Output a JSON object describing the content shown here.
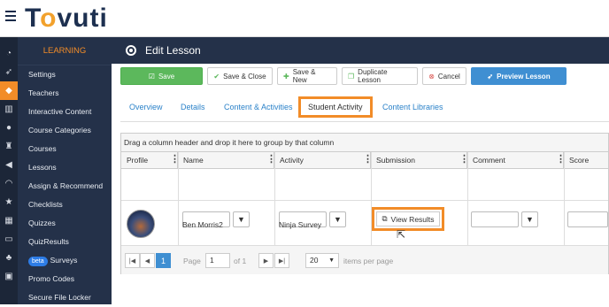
{
  "brand": {
    "logo_pre": "T",
    "logo_o": "o",
    "logo_post": "vuti"
  },
  "sidebar": {
    "section": "LEARNING",
    "items": [
      {
        "label": "Settings"
      },
      {
        "label": "Teachers"
      },
      {
        "label": "Interactive Content"
      },
      {
        "label": "Course Categories"
      },
      {
        "label": "Courses"
      },
      {
        "label": "Lessons"
      },
      {
        "label": "Assign & Recommend"
      },
      {
        "label": "Checklists"
      },
      {
        "label": "Quizzes"
      },
      {
        "label": "QuizResults"
      },
      {
        "label": "Surveys",
        "badge": "beta"
      },
      {
        "label": "Promo Codes"
      },
      {
        "label": "Secure File Locker"
      }
    ]
  },
  "iconbar": [
    "dashboard-icon",
    "rocket-icon",
    "graduation-cap-icon",
    "chart-icon",
    "users-icon",
    "trophy-icon",
    "megaphone-icon",
    "rss-icon",
    "star-icon",
    "calendar-icon",
    "card-icon",
    "sitemap-icon",
    "id-card-icon"
  ],
  "page": {
    "title": "Edit Lesson"
  },
  "toolbar": {
    "save": "Save",
    "save_close": "Save & Close",
    "save_new": "Save & New",
    "duplicate": "Duplicate Lesson",
    "cancel": "Cancel",
    "preview": "Preview Lesson"
  },
  "tabs": [
    "Overview",
    "Details",
    "Content & Activities",
    "Student Activity",
    "Content Libraries"
  ],
  "active_tab": "Student Activity",
  "grid": {
    "group_hint": "Drag a column header and drop it here to group by that column",
    "columns": [
      "Profile",
      "Name",
      "Activity",
      "Submission",
      "Comment",
      "Score"
    ],
    "rows": [
      {
        "name": "Ben Morris2",
        "activity": "Ninja Survey",
        "submission_button": "View Results"
      }
    ],
    "pager": {
      "page_label": "Page",
      "page_value": "1",
      "of_label": "of 1",
      "current": "1",
      "page_size": "20",
      "items_per_page": "items per page"
    }
  },
  "colors": {
    "accent": "#f28c28",
    "nav": "#243149",
    "link": "#2b82c9",
    "save": "#5cb85c",
    "preview": "#3f8fd2"
  }
}
